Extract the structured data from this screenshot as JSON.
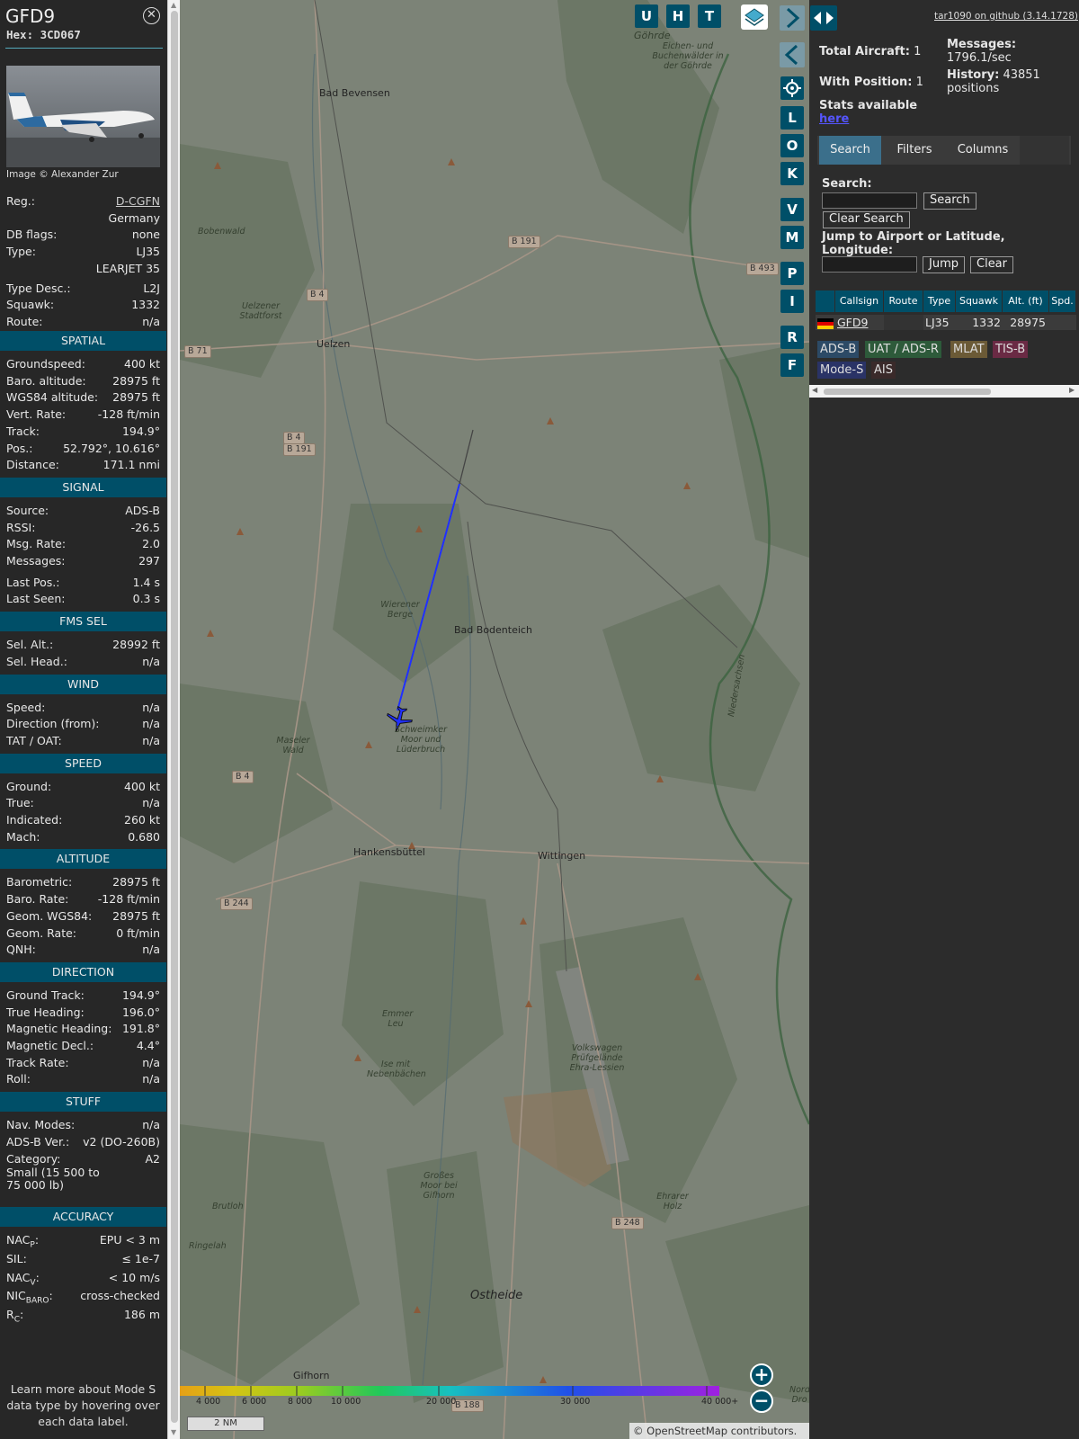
{
  "info": {
    "callsign": "GFD9",
    "hex": "Hex: 3CD067",
    "photo_credit": "Image © Alexander Zur",
    "rows_top": [
      {
        "k": "Reg.:",
        "v": "D-CGFN",
        "link": true
      },
      {
        "k": "",
        "v": "Germany"
      },
      {
        "k": "DB flags:",
        "v": "none"
      },
      {
        "k": "Type:",
        "v": "LJ35"
      },
      {
        "k": "",
        "v": "LEARJET 35"
      },
      {
        "k": "Type Desc.:",
        "v": "L2J"
      },
      {
        "k": "Squawk:",
        "v": "1332"
      },
      {
        "k": "Route:",
        "v": "n/a"
      }
    ],
    "sections": [
      {
        "title": "SPATIAL",
        "rows": [
          {
            "k": "Groundspeed:",
            "v": "400 kt"
          },
          {
            "k": "Baro. altitude:",
            "v": "28975 ft"
          },
          {
            "k": "WGS84 altitude:",
            "v": "28975 ft"
          },
          {
            "k": "Vert. Rate:",
            "v": "-128 ft/min"
          },
          {
            "k": "Track:",
            "v": "194.9°"
          },
          {
            "k": "Pos.:",
            "v": "52.792°, 10.616°"
          },
          {
            "k": "Distance:",
            "v": "171.1 nmi"
          }
        ]
      },
      {
        "title": "SIGNAL",
        "rows": [
          {
            "k": "Source:",
            "v": "ADS-B"
          },
          {
            "k": "RSSI:",
            "v": "-26.5"
          },
          {
            "k": "Msg. Rate:",
            "v": "2.0"
          },
          {
            "k": "Messages:",
            "v": "297"
          },
          {
            "k": "Last Pos.:",
            "v": "1.4 s"
          },
          {
            "k": "Last Seen:",
            "v": "0.3 s"
          }
        ]
      },
      {
        "title": "FMS SEL",
        "rows": [
          {
            "k": "Sel. Alt.:",
            "v": "28992 ft"
          },
          {
            "k": "Sel. Head.:",
            "v": "n/a"
          }
        ]
      },
      {
        "title": "WIND",
        "rows": [
          {
            "k": "Speed:",
            "v": "n/a"
          },
          {
            "k": "Direction (from):",
            "v": "n/a"
          },
          {
            "k": "TAT / OAT:",
            "v": "n/a"
          }
        ]
      },
      {
        "title": "SPEED",
        "rows": [
          {
            "k": "Ground:",
            "v": "400 kt"
          },
          {
            "k": "True:",
            "v": "n/a"
          },
          {
            "k": "Indicated:",
            "v": "260 kt"
          },
          {
            "k": "Mach:",
            "v": "0.680"
          }
        ]
      },
      {
        "title": "ALTITUDE",
        "rows": [
          {
            "k": "Barometric:",
            "v": "28975 ft"
          },
          {
            "k": "Baro. Rate:",
            "v": "-128 ft/min"
          },
          {
            "k": "Geom. WGS84:",
            "v": "28975 ft"
          },
          {
            "k": "Geom. Rate:",
            "v": "0 ft/min"
          },
          {
            "k": "QNH:",
            "v": "n/a"
          }
        ]
      },
      {
        "title": "DIRECTION",
        "rows": [
          {
            "k": "Ground Track:",
            "v": "194.9°"
          },
          {
            "k": "True Heading:",
            "v": "196.0°"
          },
          {
            "k": "Magnetic Heading:",
            "v": "191.8°"
          },
          {
            "k": "Magnetic Decl.:",
            "v": "4.4°"
          },
          {
            "k": "Track Rate:",
            "v": "n/a"
          },
          {
            "k": "Roll:",
            "v": "n/a"
          }
        ]
      },
      {
        "title": "STUFF",
        "rows": [
          {
            "k": "Nav. Modes:",
            "v": "n/a"
          },
          {
            "k": "ADS-B Ver.:",
            "v": "v2 (DO-260B)"
          },
          {
            "k": "Category:",
            "v": "A2"
          }
        ]
      },
      {
        "title": "ACCURACY",
        "rows": [
          {
            "k": "NACP:",
            "v": "EPU < 3 m"
          },
          {
            "k": "SIL:",
            "v": "≤ 1e-7"
          },
          {
            "k": "NACV:",
            "v": "< 10 m/s"
          },
          {
            "k": "NICBARO:",
            "v": "cross-checked"
          },
          {
            "k": "RC:",
            "v": "186 m"
          }
        ]
      }
    ],
    "category_desc": "Small (15 500 to 75 000 lb)",
    "footer": "Learn more about Mode S data type by hovering over each data label."
  },
  "map": {
    "labels": [
      "Bad Bevensen",
      "Uelzen",
      "Bad Bodenteich",
      "Hankensbüttel",
      "Wittingen",
      "Gifhorn",
      "Ostheide"
    ],
    "small_labels": [
      "Göhrde",
      "Eichen- und Buchenwälder in der Göhrde",
      "Bobenwald",
      "Uelzener Stadtforst",
      "Wierener Berge",
      "Schweimker Moor und Lüderbruch",
      "Maseler Wald",
      "Emmer Leu",
      "Ise mit Nebenbächen",
      "Volkswagen Prüfgelände Ehra-Lessien",
      "Großes Moor bei Gifhorn",
      "Brutloh",
      "Ringelah",
      "Ehrarer Holz",
      "Niedersachsen",
      "Nord Dro"
    ],
    "roads": [
      "B 191",
      "B 4",
      "B 71",
      "B 4",
      "B 191",
      "B 4",
      "B 244",
      "B 248",
      "B 493",
      "B 188"
    ],
    "altitude_scale": [
      "4 000",
      "6 000",
      "8 000",
      "10 000",
      "20 000",
      "30 000",
      "40 000+"
    ],
    "scale": "2 NM",
    "attribution": "© OpenStreetMap contributors.",
    "top_buttons": [
      "U",
      "H",
      "T"
    ],
    "side_buttons": [
      "L",
      "O",
      "K",
      "V",
      "M",
      "P",
      "I",
      "R",
      "F"
    ]
  },
  "right": {
    "github": "tar1090 on github (3.14.1728)",
    "total_aircraft_label": "Total Aircraft:",
    "total_aircraft": "1",
    "with_position_label": "With Position:",
    "with_position": "1",
    "messages_label": "Messages:",
    "messages_rate": "1796.1/sec",
    "history_label": "History:",
    "history": "43851 positions",
    "stats_label": "Stats available",
    "stats_link": "here",
    "tabs": [
      "Search",
      "Filters",
      "Columns"
    ],
    "search_label": "Search:",
    "search_button": "Search",
    "clear_search": "Clear Search",
    "jump_label": "Jump to Airport or Latitude, Longitude:",
    "jump_button": "Jump",
    "clear_button": "Clear",
    "columns": [
      "Callsign",
      "Route",
      "Type",
      "Squawk",
      "Alt. (ft)",
      "Spd."
    ],
    "aircraft": {
      "callsign": "GFD9",
      "route": "",
      "type": "LJ35",
      "squawk": "1332",
      "alt": "28975"
    },
    "sources": [
      "ADS-B",
      "UAT / ADS-R",
      "MLAT",
      "TIS-B",
      "Mode-S",
      "AIS"
    ],
    "source_colors": [
      "#2c4a66",
      "#2d5a3a",
      "#6b5a36",
      "#6a2a44",
      "#2a3366",
      "#3a2a2a"
    ]
  }
}
